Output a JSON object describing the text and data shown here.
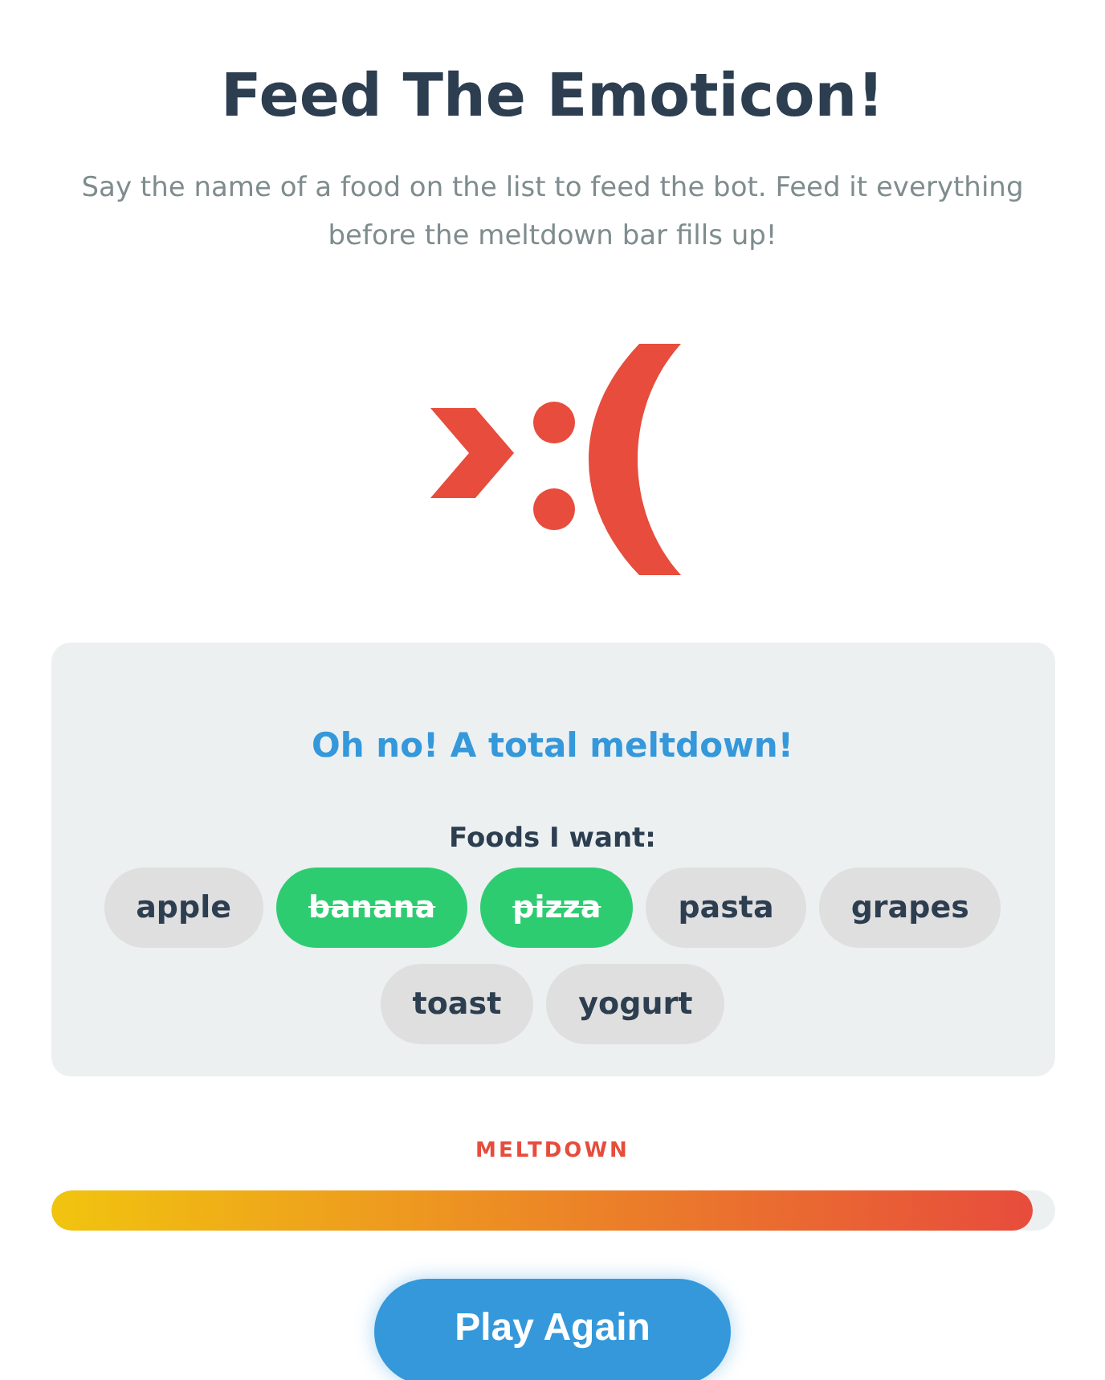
{
  "title": "Feed The Emoticon!",
  "subtitle": "Say the name of a food on the list to feed the bot. Feed it everything before the meltdown bar fills up!",
  "panel": {
    "message": "Oh no! A total meltdown!",
    "list_heading": "Foods I want:",
    "foods": [
      {
        "label": "apple",
        "eaten": false
      },
      {
        "label": "banana",
        "eaten": true
      },
      {
        "label": "pizza",
        "eaten": true
      },
      {
        "label": "pasta",
        "eaten": false
      },
      {
        "label": "grapes",
        "eaten": false
      },
      {
        "label": "toast",
        "eaten": false
      },
      {
        "label": "yogurt",
        "eaten": false
      }
    ]
  },
  "meltdown": {
    "label": "MELTDOWN",
    "level": 0.978
  },
  "button": "Play Again"
}
